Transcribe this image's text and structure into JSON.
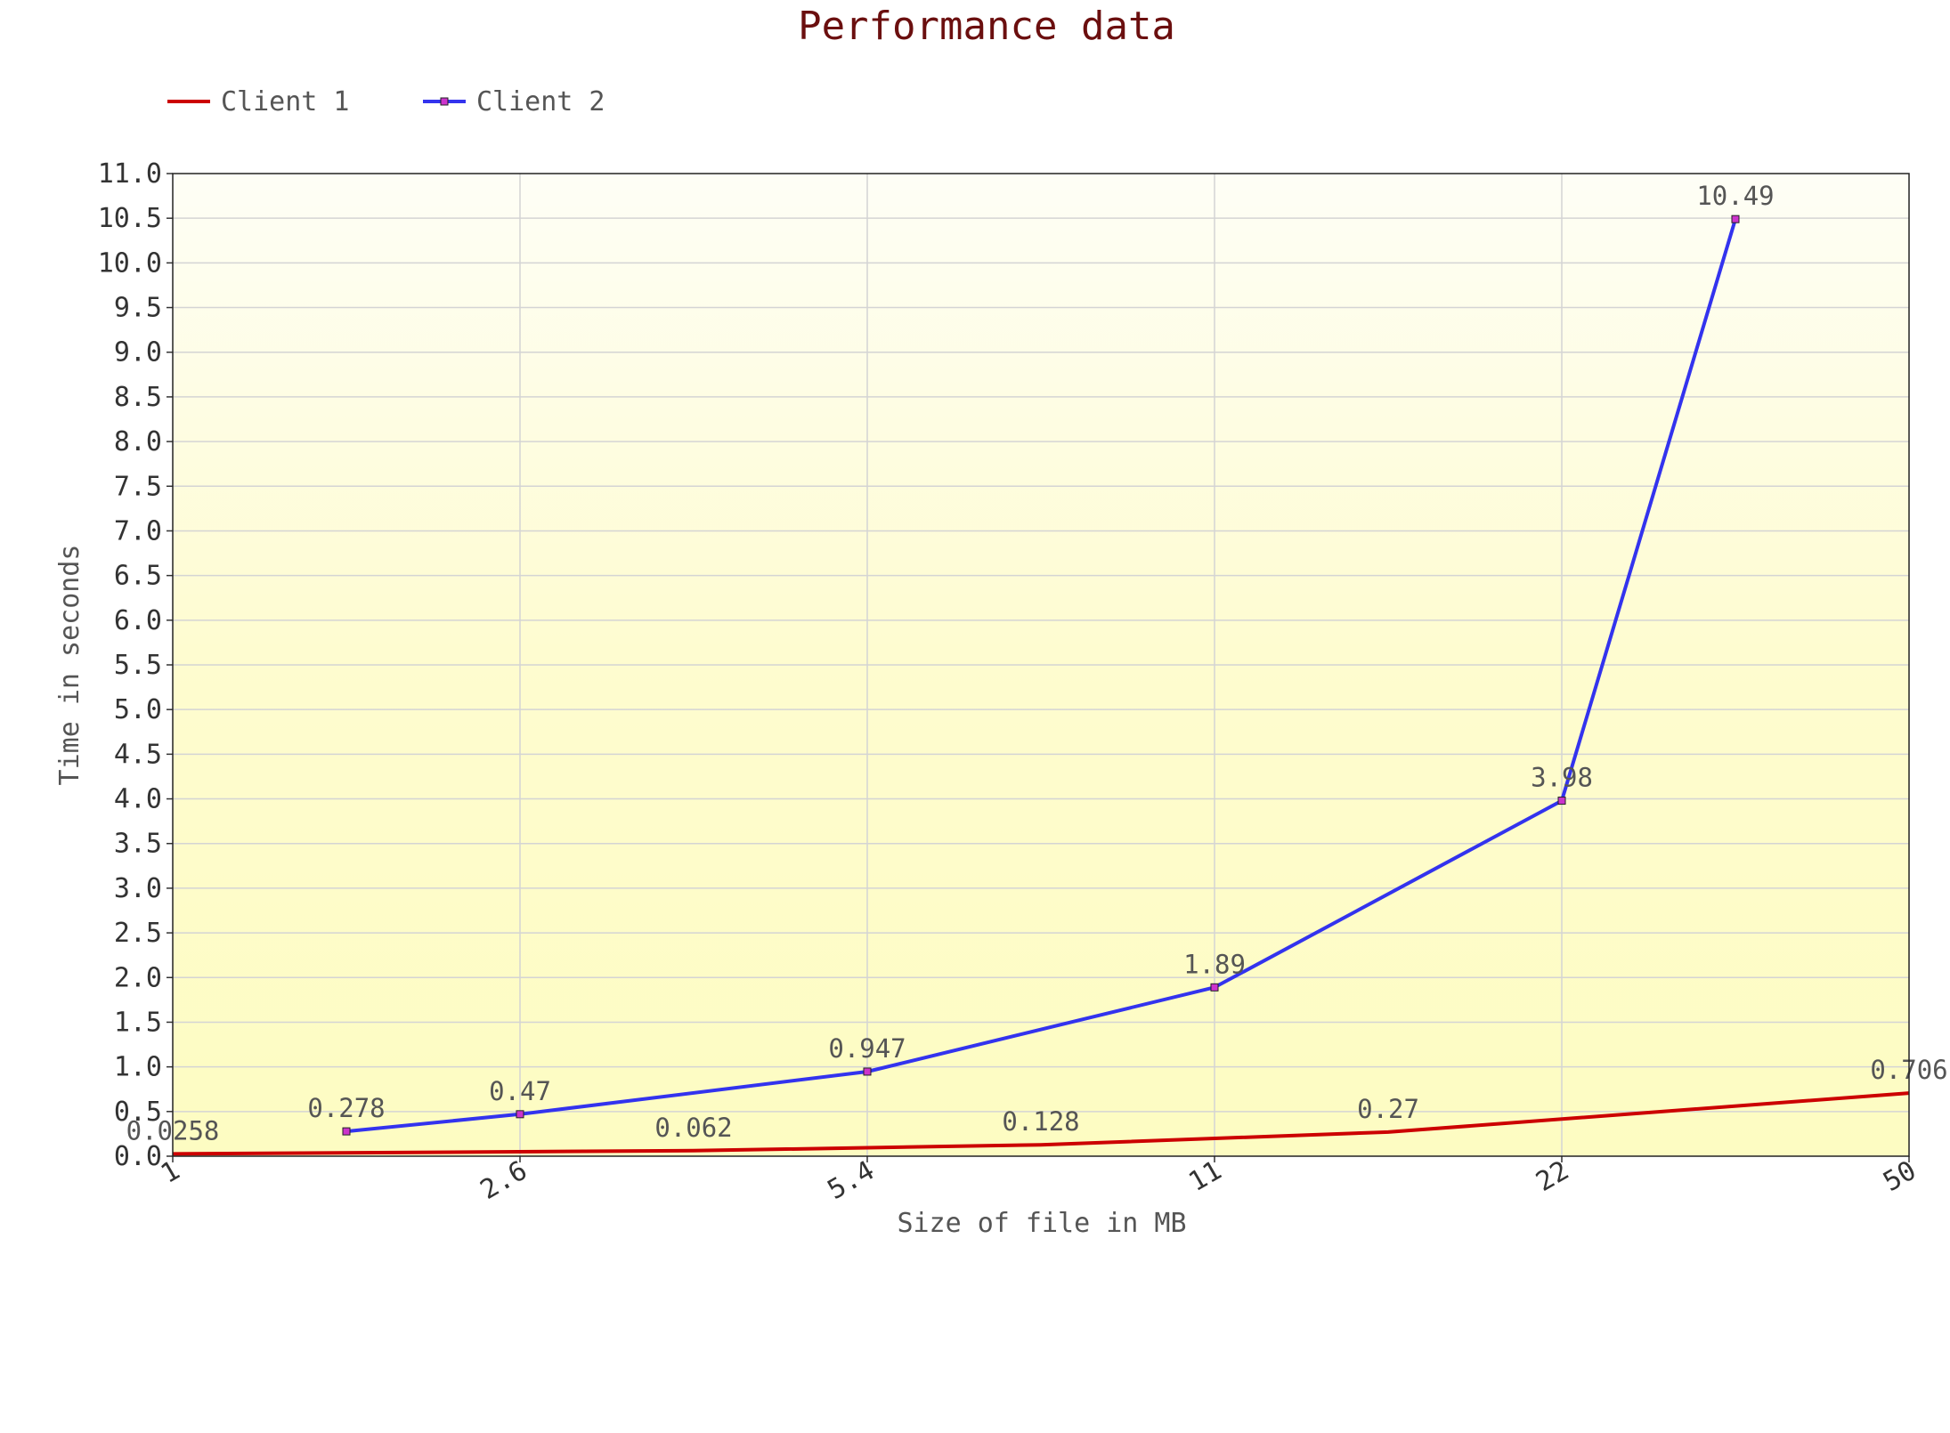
{
  "chart_data": {
    "type": "line",
    "title": "Performance data",
    "xlabel": "Size of file in MB",
    "ylabel": "Time in seconds",
    "x_ticks": [
      "1",
      "2.6",
      "5.4",
      "11",
      "22",
      "50"
    ],
    "y_ticks": [
      "0.0",
      "0.5",
      "1.0",
      "1.5",
      "2.0",
      "2.5",
      "3.0",
      "3.5",
      "4.0",
      "4.5",
      "5.0",
      "5.5",
      "6.0",
      "6.5",
      "7.0",
      "7.5",
      "8.0",
      "8.5",
      "9.0",
      "9.5",
      "10.0",
      "10.5",
      "11.0"
    ],
    "ylim": [
      0,
      11
    ],
    "grid": true,
    "legend_position": "top-left",
    "series": [
      {
        "name": "Client 1",
        "color": "#cc0000",
        "marker": false,
        "values": [
          0.0258,
          0.062,
          0.128,
          0.27,
          0.706
        ],
        "x_index": [
          0,
          1.5,
          2.5,
          3.5,
          5
        ],
        "labels": [
          "0.0258",
          "0.062",
          "0.128",
          "0.27",
          "0.706"
        ]
      },
      {
        "name": "Client 2",
        "color": "#3333ee",
        "marker": true,
        "marker_color": "#cc33cc",
        "values": [
          0.278,
          0.47,
          0.947,
          1.89,
          3.98,
          10.49
        ],
        "x_index": [
          0.5,
          1,
          2,
          3,
          4,
          4.5
        ],
        "labels": [
          "0.278",
          "0.47",
          "0.947",
          "1.89",
          "3.98",
          "10.49"
        ]
      }
    ]
  }
}
